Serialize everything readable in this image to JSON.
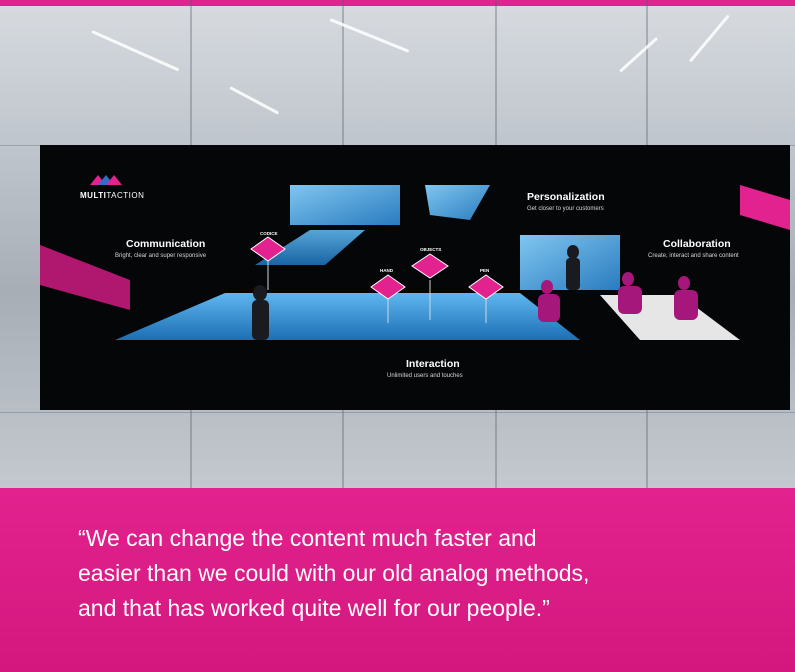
{
  "logo": {
    "bold": "MULTI",
    "thin": "TACTION"
  },
  "sections": {
    "communication": {
      "title": "Communication",
      "subtitle": "Bright, clear and super responsive"
    },
    "personalization": {
      "title": "Personalization",
      "subtitle": "Get closer to your customers"
    },
    "collaboration": {
      "title": "Collaboration",
      "subtitle": "Create, interact and share content"
    },
    "interaction": {
      "title": "Interaction",
      "subtitle": "Unlimited users and touches"
    }
  },
  "markers": {
    "codice": "CODICE",
    "hand": "HAND",
    "objects": "OBJECTS",
    "pen": "PEN"
  },
  "quote": {
    "line1": "“We can change the content much faster and",
    "line2": "easier than we could with our old analog methods,",
    "line3": "and that has worked quite well for our people.”"
  },
  "colors": {
    "brand": "#e2228e",
    "screen": "#050608",
    "floor_blue": "#2e8fd6",
    "text": "#ffffff"
  },
  "icons": [
    "multitaction-logo-icon",
    "codice-icon",
    "hand-icon",
    "objects-icon",
    "pen-icon"
  ]
}
